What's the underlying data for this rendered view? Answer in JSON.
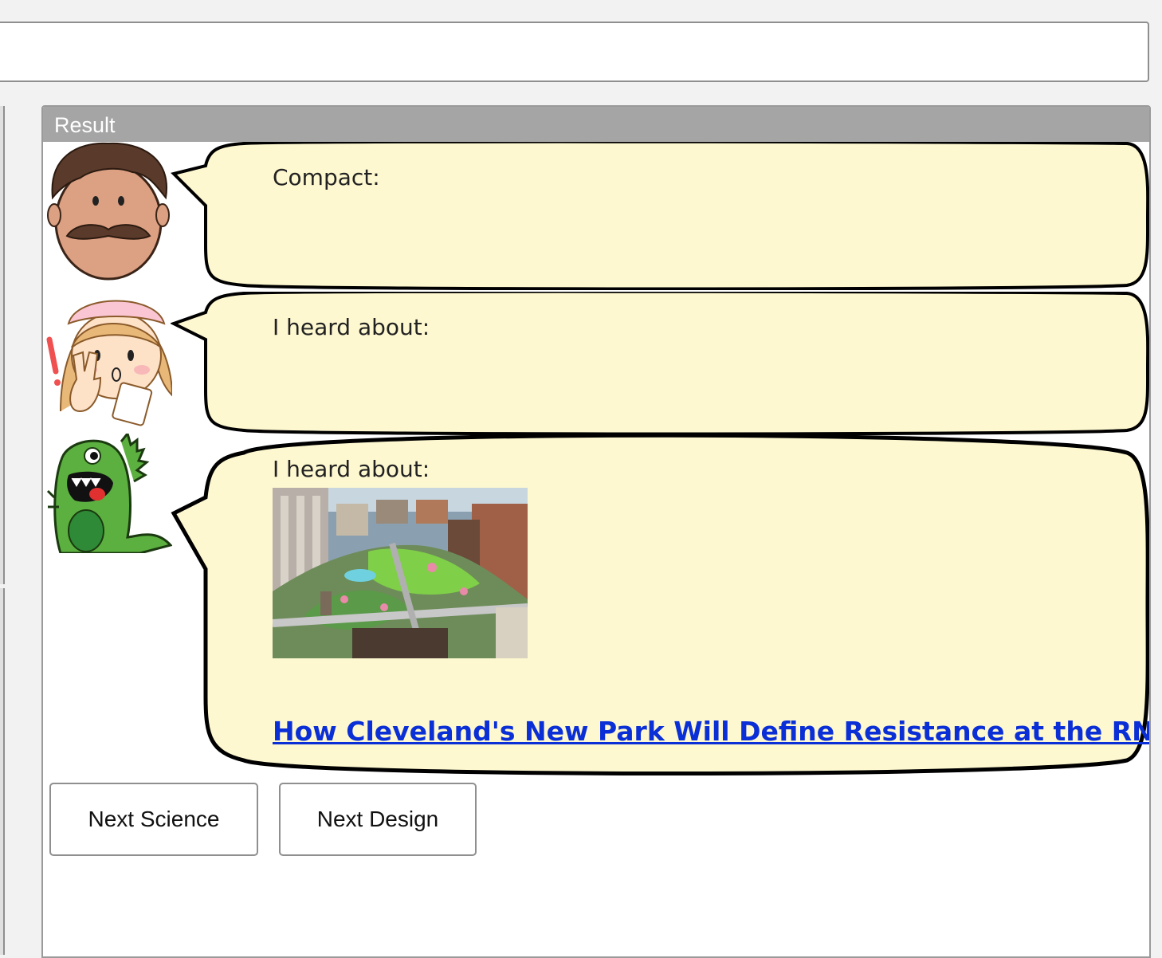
{
  "search": {
    "value": "",
    "placeholder": ""
  },
  "result_panel": {
    "title": "Result",
    "messages": [
      {
        "speaker": "mustache-man-avatar",
        "text": "Compact:"
      },
      {
        "speaker": "nurse-avatar",
        "text": "I heard about:"
      },
      {
        "speaker": "green-monster-avatar",
        "text": "I heard about:",
        "image": "aerial-park-photo",
        "link_text": "How Cleveland's New Park Will Define Resistance at the RNC"
      }
    ]
  },
  "buttons": {
    "next_science": "Next Science",
    "next_design": "Next Design"
  },
  "colors": {
    "bubble_fill": "#fef8d0",
    "link": "#0b2fd6",
    "header": "#a5a5a5"
  }
}
